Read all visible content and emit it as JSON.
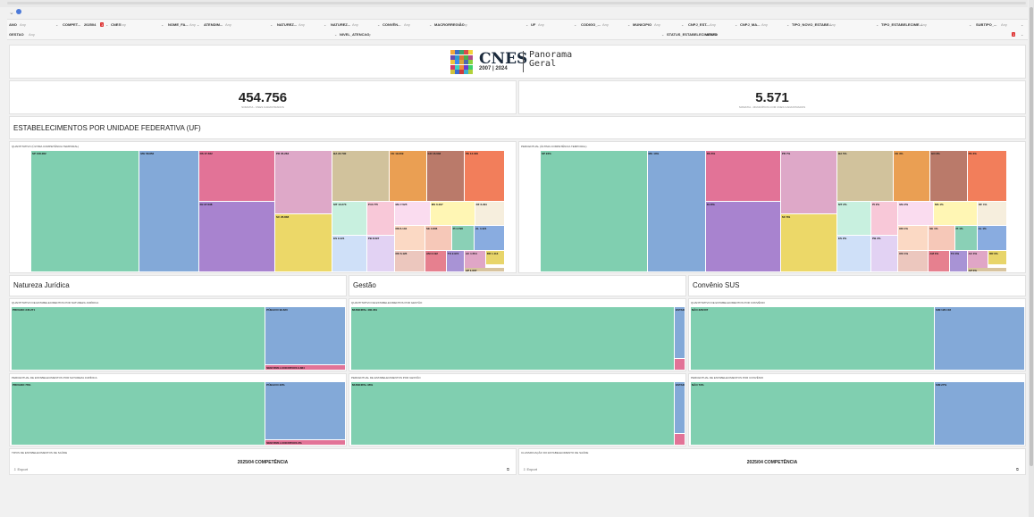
{
  "filters": {
    "row1": [
      {
        "label": "ANO",
        "value": "Any"
      },
      {
        "label": "COMPET...",
        "value": "202504"
      },
      {
        "label": "CNES",
        "value": "Any"
      },
      {
        "label": "NOME_FA...",
        "value": "Any"
      },
      {
        "label": "ATENDIM...",
        "value": "Any"
      },
      {
        "label": "NATUREZ...",
        "value": "Any"
      },
      {
        "label": "NATUREZ...",
        "value": "Any"
      },
      {
        "label": "CONVÊN...",
        "value": "Any"
      },
      {
        "label": "MACRORREGIÃO",
        "value": "Any"
      },
      {
        "label": "UF",
        "value": "Any"
      },
      {
        "label": "CODIGO_...",
        "value": "Any"
      },
      {
        "label": "MUNICIPIO",
        "value": "Any"
      },
      {
        "label": "CNPJ_EST...",
        "value": "Any"
      },
      {
        "label": "CNPJ_MA...",
        "value": "Any"
      },
      {
        "label": "TIPO_NOVO_ESTABE...",
        "value": "Any"
      },
      {
        "label": "TIPO_ESTABELECIME...",
        "value": "Any"
      },
      {
        "label": "SUBTIPO_...",
        "value": "Any"
      }
    ],
    "row2": [
      {
        "label": "GESTAO",
        "value": "Any"
      },
      {
        "label": "NIVEL_ATENCAO",
        "value": "Any"
      },
      {
        "label": "STATUS_ESTABELECIMENTO",
        "value": "ATIVO"
      }
    ],
    "badge_count": "1"
  },
  "header": {
    "brand": "CNES",
    "years": "2007 | 2024",
    "subtitle_line1": "Panorama",
    "subtitle_line2": "Geral"
  },
  "kpis": [
    {
      "value": "454.756",
      "label": "SOMATIA - CNES CADASTRADOS"
    },
    {
      "value": "5.571",
      "label": "SOMATIA - MUNICÍPIOS COM CNES CADASTRADOS"
    }
  ],
  "uf_section": {
    "title": "ESTABELECIMENTOS POR UNIDADE FEDERATIVA (UF)",
    "left_caption": "QUANTITATIVO (ÚLTIMA COMPETÊNCIA TEMPORAL)",
    "right_caption": "PERCENTUAL (ÚLTIMA COMPETÊNCIA TEMPORAL)",
    "left_tiles": [
      "SP 108.282",
      "MG 58.852",
      "RS 37.662",
      "PR 35.263",
      "BA 22.790",
      "CE 19.209",
      "GO 16.033",
      "PE 13.046",
      "RJ 37.038",
      "SC 26.838",
      "MT 10.273",
      "PI 8.775",
      "MA 7.525",
      "MS 6.297",
      "DF 6.291",
      "ES 9.421",
      "PB 8.697",
      "RN 6.104",
      "SE 4.806",
      "PI 4.798",
      "AL 4.421",
      "RO 6.126",
      "AM 3.192",
      "TO 2.972",
      "AC 1.554",
      "RR 1.113",
      "AP 1.007"
    ],
    "right_tiles": [
      "SP 23%",
      "MG 13%",
      "RS 8%",
      "PR 7%",
      "BA 5%",
      "CE 3%",
      "GO 3%",
      "PE 3%",
      "RJ 8%",
      "SC 6%",
      "MT 2%",
      "PI 2%",
      "MA 2%",
      "MS 1%",
      "DF 1%",
      "ES 2%",
      "PB 2%",
      "RN 1%",
      "SE 1%",
      "PI 1%",
      "AL 1%",
      "RO 1%",
      "AM 0%",
      "TO 0%",
      "AC 0%",
      "RR 0%",
      "AP 0%"
    ]
  },
  "sections": {
    "natureza": "Natureza Jurídica",
    "gestao": "Gestão",
    "convenio": "Convênio SUS"
  },
  "natureza": {
    "cap_q": "QUANTITATIVO DE ESTABELECIMENTOS POR NATUREZA JURÍDICA",
    "cap_p": "PERCENTUAL DE ESTABELECIMENTOS POR NATUREZA JURÍDICA",
    "q": [
      "PRIVADO 345.271",
      "PÚBLICO 99.620",
      "SEM FINS LUCRATIVOS 9.864"
    ],
    "p": [
      "PRIVADO 76%",
      "PÚBLICO 22%",
      "SEM FINS LUCRATIVOS 2%"
    ]
  },
  "gestao": {
    "cap_q": "QUANTITATIVO DE ESTABELECIMENTOS POR GESTÃO",
    "cap_p": "PERCENTUAL DE ESTABELECIMENTOS POR GESTÃO",
    "q": [
      "MUNICIPAL 430.361",
      "ESTAD. 7.398"
    ],
    "p": [
      "MUNICIPAL 96%",
      "ESTAD. 2%"
    ]
  },
  "convenio": {
    "cap_q": "QUANTITATIVO DE ESTABELECIMENTOS POR CONVÊNIO",
    "cap_p": "PERCENTUAL DE ESTABELECIMENTOS POR CONVÊNIO",
    "q": [
      "NÃO 328.507",
      "SIM 126.103"
    ],
    "p": [
      "NÃO 73%",
      "SIM 27%"
    ]
  },
  "bottom": {
    "left_caption": "TIPOS DE ESTABELECIMENTOS DE SAÚDE",
    "right_caption": "CLASSIFICAÇÃO DO ESTABELECIMENTO DE SAÚDE",
    "title": "2025/04 COMPETÊNCIA",
    "export": "Export"
  },
  "colors": {
    "green": "#80cfb0",
    "blue": "#83a9d8",
    "pink": "#e27397",
    "purple": "#a883cf",
    "mauve": "#dea8c8",
    "yellow": "#ecd868",
    "tan": "#d1c29c",
    "orange": "#ea9f53",
    "brown": "#ba7a6a",
    "coral": "#f27e5b"
  }
}
